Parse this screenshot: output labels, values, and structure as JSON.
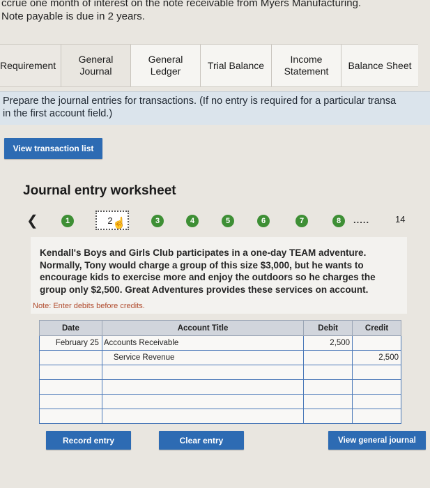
{
  "top_text": {
    "line1": "ccrue one month of interest on the note receivable from Myers Manufacturing.",
    "line2": "Note payable is due in 2 years."
  },
  "tabs": [
    {
      "label": "Requirement",
      "active": false
    },
    {
      "label": "General\nJournal",
      "active": true
    },
    {
      "label": "General\nLedger",
      "active": false
    },
    {
      "label": "Trial Balance",
      "active": false
    },
    {
      "label": "Income\nStatement",
      "active": false
    },
    {
      "label": "Balance Sheet",
      "active": false
    }
  ],
  "instructions": {
    "line1": "Prepare the journal entries for transactions. (If no entry is required for a particular transa",
    "line2": "in the first account field.)"
  },
  "buttons": {
    "view_transaction_list": "View transaction list",
    "record_entry": "Record entry",
    "clear_entry": "Clear entry",
    "view_general_journal": "View general journal"
  },
  "worksheet": {
    "title": "Journal entry worksheet",
    "pager": {
      "prev_icon": "chevron-left-icon",
      "steps": [
        "1",
        "2",
        "3",
        "4",
        "5",
        "6",
        "7",
        "8"
      ],
      "current": "2",
      "ellipsis": ".....",
      "last": "14",
      "step_color": "#3e8f35"
    },
    "narrative": "Kendall's Boys and Girls Club participates in a one-day TEAM adventure. Normally, Tony would charge a group of this size $3,000, but he wants to encourage kids to exercise more and enjoy the outdoors so he charges the group only $2,500. Great Adventures provides these services on account.",
    "note": "Note: Enter debits before credits."
  },
  "journal_table": {
    "headers": {
      "date": "Date",
      "account": "Account Title",
      "debit": "Debit",
      "credit": "Credit"
    },
    "rows": [
      {
        "date": "February 25",
        "account": "Accounts Receivable",
        "debit": "2,500",
        "credit": ""
      },
      {
        "date": "",
        "account": "Service Revenue",
        "debit": "",
        "credit": "2,500"
      },
      {
        "date": "",
        "account": "",
        "debit": "",
        "credit": ""
      },
      {
        "date": "",
        "account": "",
        "debit": "",
        "credit": ""
      },
      {
        "date": "",
        "account": "",
        "debit": "",
        "credit": ""
      },
      {
        "date": "",
        "account": "",
        "debit": "",
        "credit": ""
      }
    ]
  },
  "colors": {
    "button_blue": "#2d6bb3",
    "instruction_bg": "#dbe4ec",
    "note_text": "#b04a2c"
  }
}
